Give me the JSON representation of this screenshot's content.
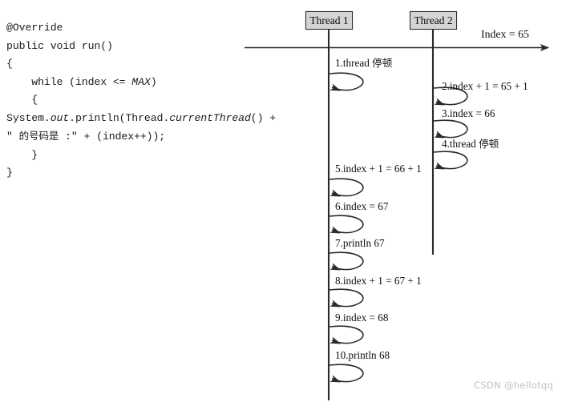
{
  "code": {
    "lines": [
      [
        {
          "t": "@Override",
          "style": "plain"
        }
      ],
      [
        {
          "t": "public void run()",
          "style": "plain"
        }
      ],
      [
        {
          "t": "{",
          "style": "plain"
        }
      ],
      [
        {
          "t": "    while (index <= ",
          "style": "plain"
        },
        {
          "t": "MAX",
          "style": "italic"
        },
        {
          "t": ")",
          "style": "plain"
        }
      ],
      [
        {
          "t": "    {",
          "style": "plain"
        }
      ],
      [
        {
          "t": "System.",
          "style": "plain"
        },
        {
          "t": "out",
          "style": "italic"
        },
        {
          "t": ".println(Thread.",
          "style": "plain"
        },
        {
          "t": "currentThread",
          "style": "italic"
        },
        {
          "t": "() +",
          "style": "plain"
        }
      ],
      [
        {
          "t": "\" ",
          "style": "plain"
        },
        {
          "t": "的号码是",
          "style": "cjk"
        },
        {
          "t": " :\" + (index++));",
          "style": "plain"
        }
      ],
      [
        {
          "t": "    }",
          "style": "plain"
        }
      ],
      [
        {
          "t": "}",
          "style": "plain"
        }
      ]
    ]
  },
  "diagram": {
    "lifelines": [
      {
        "id": "thread-1",
        "label": "Thread 1"
      },
      {
        "id": "thread-2",
        "label": "Thread 2"
      }
    ],
    "timeline": {
      "index_label": "Index = 65"
    },
    "steps": [
      {
        "n": "1",
        "lane": "thread-1",
        "text": "1.thread ",
        "cjk": "停顿"
      },
      {
        "n": "2",
        "lane": "thread-2",
        "text": "2.index + 1 = 65 + 1",
        "cjk": ""
      },
      {
        "n": "3",
        "lane": "thread-2",
        "text": "3.index = 66",
        "cjk": ""
      },
      {
        "n": "4",
        "lane": "thread-2",
        "text": "4.thread ",
        "cjk": "停顿"
      },
      {
        "n": "5",
        "lane": "thread-1",
        "text": "5.index + 1 = 66 + 1",
        "cjk": ""
      },
      {
        "n": "6",
        "lane": "thread-1",
        "text": "6.index = 67",
        "cjk": ""
      },
      {
        "n": "7",
        "lane": "thread-1",
        "text": "7.println 67",
        "cjk": ""
      },
      {
        "n": "8",
        "lane": "thread-1",
        "text": "8.index + 1 = 67 + 1",
        "cjk": ""
      },
      {
        "n": "9",
        "lane": "thread-1",
        "text": "9.index = 68",
        "cjk": ""
      },
      {
        "n": "10",
        "lane": "thread-1",
        "text": "10.println 68",
        "cjk": ""
      }
    ]
  },
  "watermark": {
    "text": "CSDN @hellotqq"
  },
  "colors": {
    "stroke": "#2a2a2a",
    "box_fill": "#d4d4d4",
    "text": "#101010",
    "watermark": "#c2c2c2"
  }
}
